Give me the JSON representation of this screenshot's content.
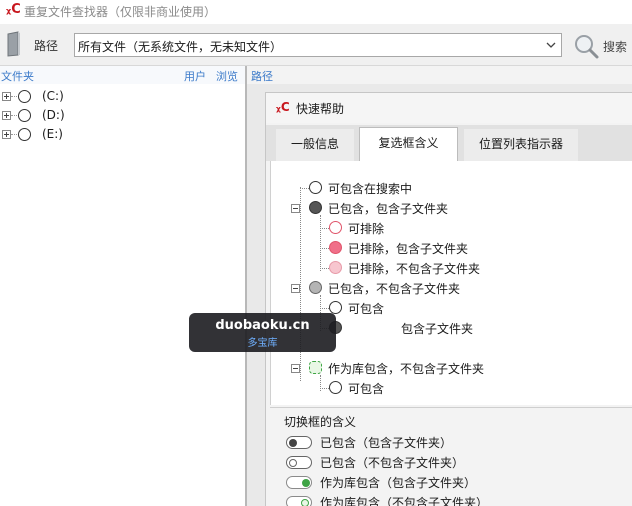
{
  "window": {
    "title": "重复文件查找器（仅限非商业使用）"
  },
  "toolbar": {
    "path_label": "路径",
    "path_value": "所有文件（无系统文件，无未知文件）",
    "search_label": "搜索"
  },
  "left_pane": {
    "header_folder": "文件夹",
    "header_user": "用户",
    "header_browse": "浏览",
    "drives": [
      "(C:)",
      "(D:)",
      "(E:)"
    ]
  },
  "right_pane": {
    "header_path": "路径"
  },
  "dialog": {
    "title": "快速帮助",
    "tabs": [
      "一般信息",
      "复选框含义",
      "位置列表指示器"
    ],
    "active_tab": "复选框含义",
    "tree": [
      "可包含在搜索中",
      "已包含，包含子文件夹",
      "可排除",
      "已排除，包含子文件夹",
      "已排除，不包含子文件夹",
      "已包含，不包含子文件夹",
      "可包含",
      "包含子文件夹",
      "作为库包含，不包含子文件夹",
      "可包含"
    ],
    "toggle_section_title": "切换框的含义",
    "toggles": [
      "已包含（包含子文件夹）",
      "已包含（不包含子文件夹）",
      "作为库包含（包含子文件夹）",
      "作为库包含（不包含子文件夹）"
    ]
  },
  "watermark": {
    "main": "duobaoku.cn",
    "sub": "多宝库"
  },
  "colors": {
    "accent_link": "#3b7ac9",
    "logo_red": "#c8171e",
    "excluded_pink": "#f07089",
    "library_green": "#3ea445"
  }
}
